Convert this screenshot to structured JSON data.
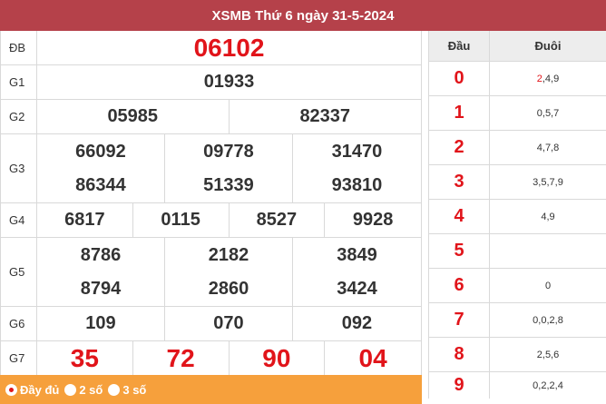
{
  "header": {
    "title": "XSMB Thứ 6 ngày 31-5-2024"
  },
  "prizes": {
    "db": {
      "label": "ĐB",
      "numbers": [
        "06102"
      ]
    },
    "g1": {
      "label": "G1",
      "numbers": [
        "01933"
      ]
    },
    "g2": {
      "label": "G2",
      "numbers": [
        "05985",
        "82337"
      ]
    },
    "g3": {
      "label": "G3",
      "numbers": [
        "66092",
        "09778",
        "31470",
        "86344",
        "51339",
        "93810"
      ]
    },
    "g4": {
      "label": "G4",
      "numbers": [
        "6817",
        "0115",
        "8527",
        "9928"
      ]
    },
    "g5": {
      "label": "G5",
      "numbers": [
        "8786",
        "2182",
        "3849",
        "8794",
        "2860",
        "3424"
      ]
    },
    "g6": {
      "label": "G6",
      "numbers": [
        "109",
        "070",
        "092"
      ]
    },
    "g7": {
      "label": "G7",
      "numbers": [
        "35",
        "72",
        "90",
        "04"
      ]
    }
  },
  "footer": {
    "options": [
      {
        "label": "Đầy đủ",
        "selected": true
      },
      {
        "label": "2 số",
        "selected": false
      },
      {
        "label": "3 số",
        "selected": false
      }
    ]
  },
  "loto": {
    "header_dau": "Đầu",
    "header_duoi": "Đuôi",
    "rows": [
      {
        "dau": "0",
        "duoi_highlight": "2",
        "duoi_rest": ",4,9"
      },
      {
        "dau": "1",
        "duoi_highlight": "",
        "duoi_rest": "0,5,7"
      },
      {
        "dau": "2",
        "duoi_highlight": "",
        "duoi_rest": "4,7,8"
      },
      {
        "dau": "3",
        "duoi_highlight": "",
        "duoi_rest": "3,5,7,9"
      },
      {
        "dau": "4",
        "duoi_highlight": "",
        "duoi_rest": "4,9"
      },
      {
        "dau": "5",
        "duoi_highlight": "",
        "duoi_rest": ""
      },
      {
        "dau": "6",
        "duoi_highlight": "",
        "duoi_rest": "0"
      },
      {
        "dau": "7",
        "duoi_highlight": "",
        "duoi_rest": "0,0,2,8"
      },
      {
        "dau": "8",
        "duoi_highlight": "",
        "duoi_rest": "2,5,6"
      },
      {
        "dau": "9",
        "duoi_highlight": "",
        "duoi_rest": "0,2,2,4"
      }
    ]
  },
  "colors": {
    "header_bg": "#b5414a",
    "footer_bg": "#f6a03c",
    "accent_red": "#e1141a"
  }
}
